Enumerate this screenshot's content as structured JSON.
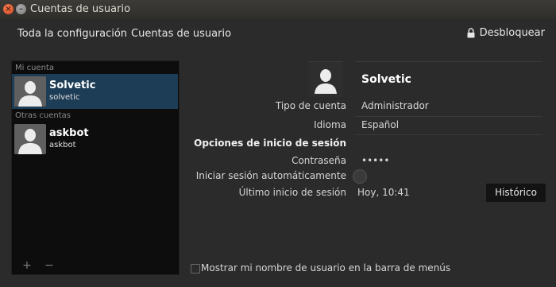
{
  "window": {
    "title": "Cuentas de usuario",
    "close_glyph": "×",
    "minimize_glyph": "–"
  },
  "toolbar": {
    "all_settings": "Toda la configuración",
    "current": "Cuentas de usuario",
    "unlock": "Desbloquear",
    "unlock_icon": "lock-icon"
  },
  "sidebar": {
    "my_account_label": "Mi cuenta",
    "other_accounts_label": "Otras cuentas",
    "users": [
      {
        "name": "Solvetic",
        "login": "solvetic",
        "selected": true
      },
      {
        "name": "askbot",
        "login": "askbot",
        "selected": false
      }
    ],
    "add_glyph": "+",
    "remove_glyph": "−"
  },
  "details": {
    "display_name": "Solvetic",
    "account_type_label": "Tipo de cuenta",
    "account_type_value": "Administrador",
    "language_label": "Idioma",
    "language_value": "Español",
    "login_options_heading": "Opciones de inicio de sesión",
    "password_label": "Contraseña",
    "password_value": "•••••",
    "auto_login_label": "Iniciar sesión automáticamente",
    "auto_login_on": false,
    "last_login_label": "Último inicio de sesión",
    "last_login_value": "Hoy, 10:41",
    "history_button": "Histórico"
  },
  "footer": {
    "show_username_label": "Mostrar mi nombre de usuario en la barra de menús",
    "show_username_checked": false
  },
  "colors": {
    "selected_row": "#1d3c55",
    "close_button": "#e05a2b",
    "background": "#2b2b2b"
  }
}
